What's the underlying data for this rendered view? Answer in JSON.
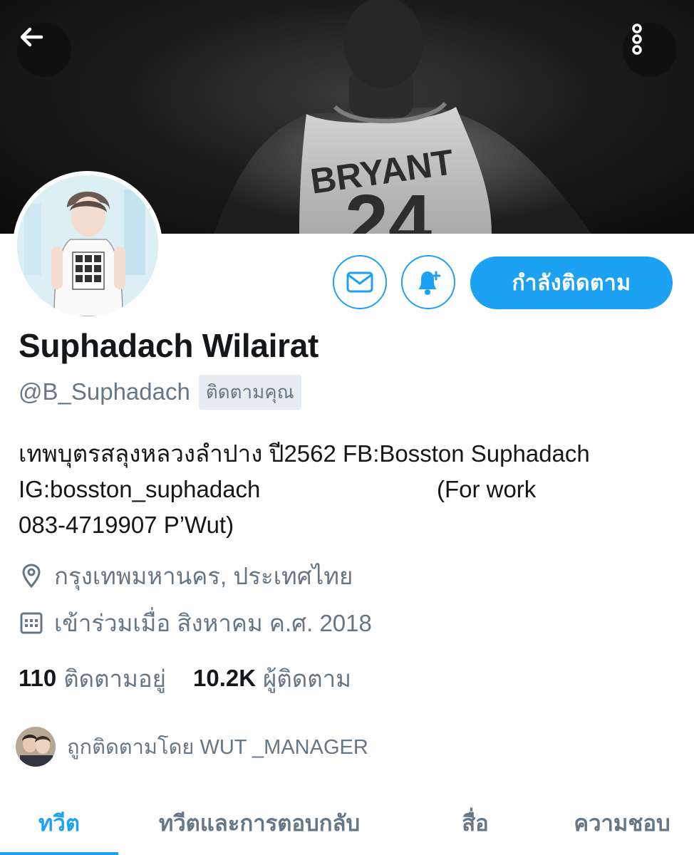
{
  "profile": {
    "name": "Suphadach Wilairat",
    "handle": "@B_Suphadach",
    "follows_you": "ติดตามคุณ",
    "bio_lines": [
      "เทพบุตรสลุงหลวงลำปาง ปี2562 FB:Bosston Suphadach",
      "IG:bosston_suphadach                           (For work",
      "083-4719907 P’Wut)"
    ],
    "location": "กรุงเทพมหานคร, ประเทศไทย",
    "joined": "เข้าร่วมเมื่อ สิงหาคม ค.ศ. 2018",
    "banner_jersey_text": "BRYANT",
    "banner_jersey_number": "24"
  },
  "actions": {
    "following_label": "กำลังติดตาม"
  },
  "stats": {
    "following_count": "110",
    "following_label": "ติดตามอยู่",
    "followers_count": "10.2K",
    "followers_label": "ผู้ติดตาม"
  },
  "followed_by": "ถูกติดตามโดย WUT _MANAGER",
  "tabs": [
    {
      "label": "ทวีต",
      "active": true
    },
    {
      "label": "ทวีตและการตอบกลับ",
      "active": false
    },
    {
      "label": "สื่อ",
      "active": false
    },
    {
      "label": "ความชอบ",
      "active": false
    }
  ],
  "icons": {
    "back": "arrow-left-icon",
    "more": "more-vertical-icon",
    "message": "envelope-icon",
    "notify": "bell-plus-icon",
    "location": "map-pin-icon",
    "calendar": "calendar-icon"
  },
  "colors": {
    "accent": "#1da1f2",
    "secondary_text": "#657786",
    "primary_text": "#14171a"
  }
}
